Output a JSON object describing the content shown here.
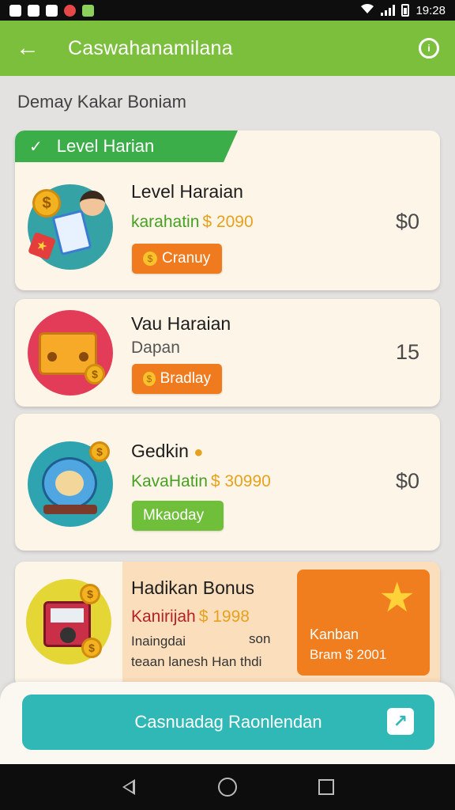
{
  "status_bar": {
    "time": "19:28"
  },
  "app_bar": {
    "title": "Caswahanamilana"
  },
  "section_title": "Demay Kakar Boniam",
  "cards": [
    {
      "ribbon": "Level Harian",
      "title": "Level Haraian",
      "subtitle_text": "karahatin",
      "subtitle_amount": "$ 2090",
      "button": "Cranuy",
      "value": "$0"
    },
    {
      "title": "Vau Haraian",
      "subtitle_text": "Dapan",
      "button": "Bradlay",
      "value": "15"
    },
    {
      "title": "Gedkin",
      "subtitle_text": "KavaHatin",
      "subtitle_amount": "$ 30990",
      "button": "Mkaoday",
      "value": "$0"
    },
    {
      "title": "Hadikan Bonus",
      "subtitle_text": "Kanirijah",
      "subtitle_amount": "$ 1998",
      "desc_line1": "Inaingdai",
      "desc_line2": "teaan lanesh Han thdi",
      "desc_right": "son",
      "promo_line1": "Kanban",
      "promo_line2": "Bram $ 2001"
    }
  ],
  "cta_label": "Casnuadag Raonlendan",
  "colors": {
    "app_bar": "#7cbf3d",
    "ribbon": "#3bae49",
    "pill_orange": "#f07b1e",
    "pill_green": "#6fbf3b",
    "cta": "#2fb8b6",
    "card_bg": "#fdf5e8"
  },
  "icons": [
    "back-arrow-icon",
    "help-icon",
    "check-icon",
    "coin-icon",
    "star-icon",
    "arrow-icon",
    "nav-back-icon",
    "nav-home-icon",
    "nav-recent-icon"
  ]
}
